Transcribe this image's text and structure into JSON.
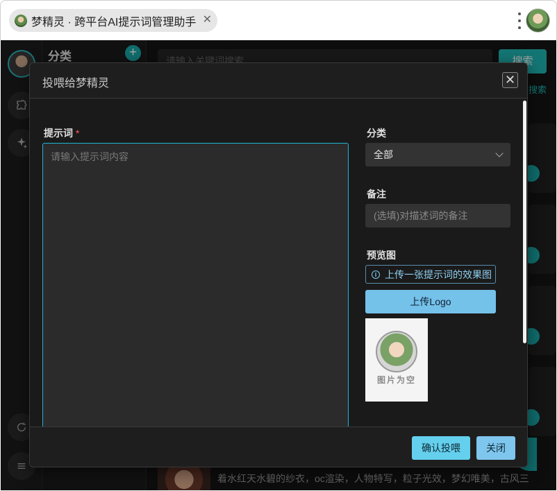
{
  "browser": {
    "tab_title": "梦精灵 · 跨平台AI提示词管理助手",
    "tab_close": "✕"
  },
  "background": {
    "category_title": "分类",
    "add_symbol": "+",
    "search_placeholder": "请输入关键词搜索",
    "search_button": "搜索",
    "search_link": "搜索",
    "bottom_text": "着水红天水碧的纱衣，oc渲染，人物特写，粒子光效，梦幻唯美，古风三"
  },
  "modal": {
    "title": "投喂给梦精灵",
    "close_symbol": "✕",
    "prompt_label": "提示词",
    "required_mark": "*",
    "prompt_placeholder": "请输入提示词内容",
    "category_label": "分类",
    "category_value": "全部",
    "note_label": "备注",
    "note_placeholder": "(选填)对描述词的备注",
    "preview_label": "预览图",
    "upload_hint": "上传一张提示词的效果图",
    "info_symbol": "i",
    "upload_button": "上传Logo",
    "preview_empty_text": "图片为空",
    "confirm_button": "确认投喂",
    "close_button": "关闭"
  },
  "colors": {
    "accent": "#1fb6b3",
    "primary_button": "#64d0ee",
    "required": "#ff5c5c"
  },
  "icons": {
    "rail": [
      "puzzle-icon",
      "sparkle-icon",
      "refresh-icon",
      "menu-icon"
    ]
  }
}
